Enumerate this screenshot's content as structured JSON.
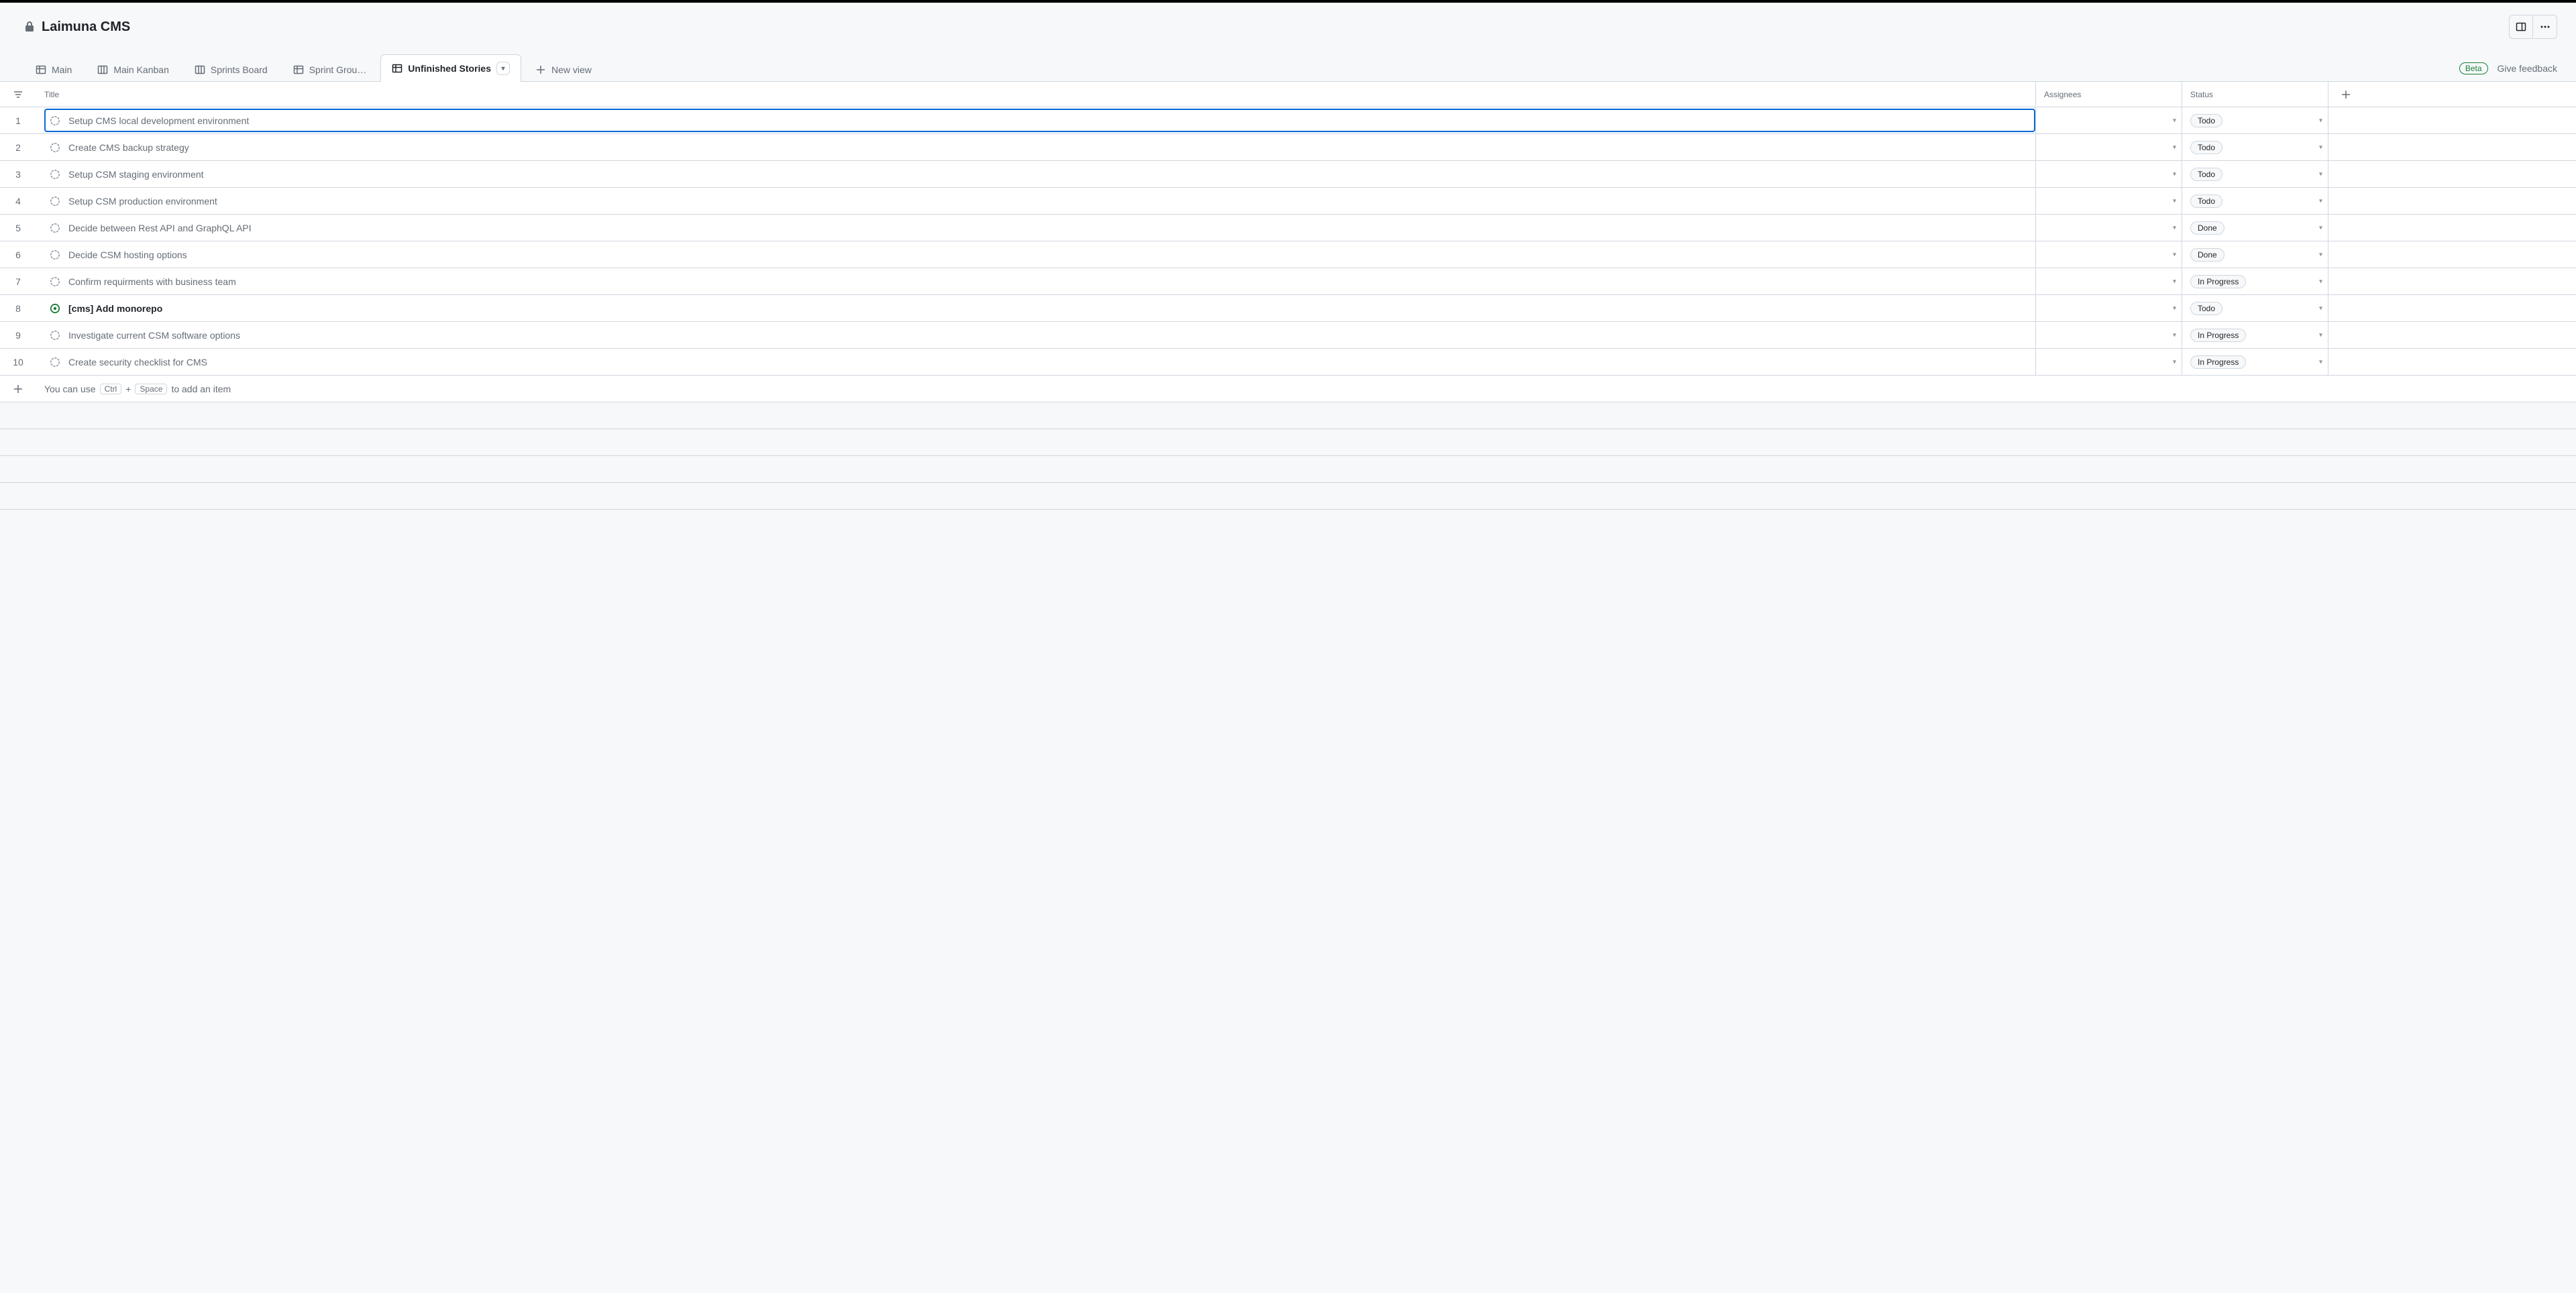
{
  "header": {
    "title": "Laimuna CMS"
  },
  "tabs": [
    {
      "label": "Main",
      "type": "table"
    },
    {
      "label": "Main Kanban",
      "type": "board"
    },
    {
      "label": "Sprints Board",
      "type": "board"
    },
    {
      "label": "Sprint Grou…",
      "type": "table"
    },
    {
      "label": "Unfinished Stories",
      "type": "table",
      "active": true
    }
  ],
  "new_view_label": "New view",
  "beta_label": "Beta",
  "feedback_label": "Give feedback",
  "columns": {
    "title": "Title",
    "assignees": "Assignees",
    "status": "Status"
  },
  "rows": [
    {
      "num": "1",
      "title": "Setup CMS local development environment",
      "status": "Todo",
      "selected": true,
      "kind": "draft"
    },
    {
      "num": "2",
      "title": "Create CMS backup strategy",
      "status": "Todo",
      "kind": "draft"
    },
    {
      "num": "3",
      "title": "Setup CSM staging environment",
      "status": "Todo",
      "kind": "draft"
    },
    {
      "num": "4",
      "title": "Setup CSM production environment",
      "status": "Todo",
      "kind": "draft"
    },
    {
      "num": "5",
      "title": "Decide between Rest API and GraphQL API",
      "status": "Done",
      "kind": "draft"
    },
    {
      "num": "6",
      "title": "Decide CSM hosting options",
      "status": "Done",
      "kind": "draft"
    },
    {
      "num": "7",
      "title": "Confirm requirments with business team",
      "status": "In Progress",
      "kind": "draft"
    },
    {
      "num": "8",
      "title": "[cms] Add monorepo",
      "status": "Todo",
      "kind": "issue",
      "active": true
    },
    {
      "num": "9",
      "title": "Investigate current CSM software options",
      "status": "In Progress",
      "kind": "draft"
    },
    {
      "num": "10",
      "title": "Create security checklist for CMS",
      "status": "In Progress",
      "kind": "draft"
    }
  ],
  "add_hint": {
    "prefix": "You can use",
    "key1": "Ctrl",
    "plus": "+",
    "key2": "Space",
    "suffix": "to add an item"
  }
}
